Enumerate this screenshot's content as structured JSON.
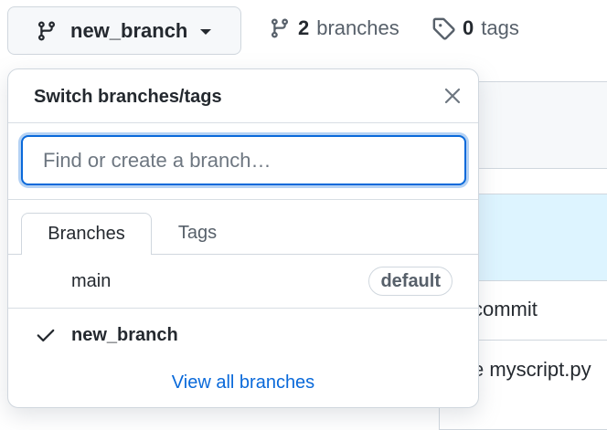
{
  "topbar": {
    "current_branch": "new_branch",
    "branches_count": "2",
    "branches_label": "branches",
    "tags_count": "0",
    "tags_label": "tags"
  },
  "dropdown": {
    "title": "Switch branches/tags",
    "filter_placeholder": "Find or create a branch…",
    "tabs": [
      {
        "label": "Branches",
        "selected": true
      },
      {
        "label": "Tags",
        "selected": false
      }
    ],
    "branches": [
      {
        "name": "main",
        "badge": "default",
        "checked": false
      },
      {
        "name": "new_branch",
        "badge": "",
        "checked": true
      }
    ],
    "view_all_label": "View all branches"
  },
  "background": {
    "row1_text": "commit",
    "row2_text": "e myscript.py"
  },
  "colors": {
    "accent": "#0969da",
    "border": "#d0d7de",
    "selected_row_bg": "#ddf4ff"
  }
}
